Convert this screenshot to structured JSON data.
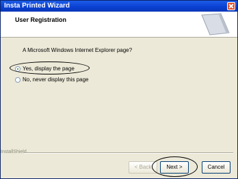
{
  "window": {
    "title": "Insta Printed Wizard"
  },
  "header": {
    "title": "User Registration"
  },
  "body": {
    "prompt": "A Microsoft Windows Internet Explorer page?",
    "options": [
      {
        "label": "Yes, display the page",
        "selected": true
      },
      {
        "label": "No, never display this page",
        "selected": false
      }
    ]
  },
  "footer": {
    "brand": "InstallShield",
    "buttons": {
      "back": "< Back",
      "next": "Next >",
      "cancel": "Cancel"
    }
  },
  "colors": {
    "titlebar": "#0a3fd0",
    "dialog": "#ece9d8",
    "annotation": "#000000"
  }
}
